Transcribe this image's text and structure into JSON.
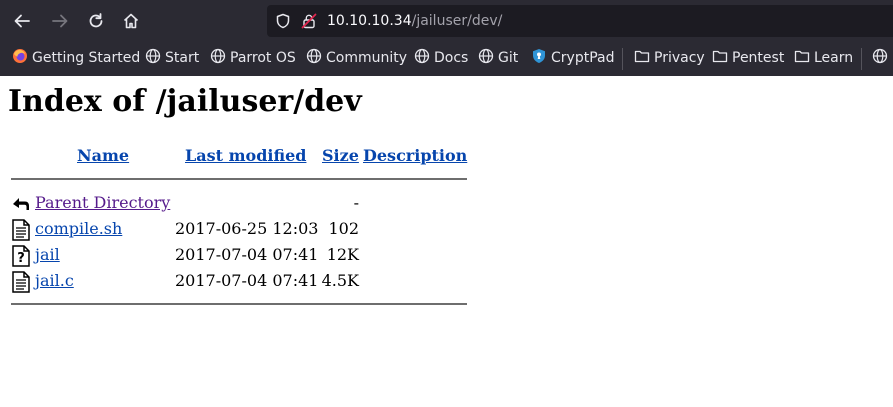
{
  "browser": {
    "url_host": "10.10.10.34",
    "url_path": "/jailuser/dev/",
    "bookmarks": [
      {
        "label": "Getting Started",
        "icon": "firefox-icon"
      },
      {
        "label": "Start",
        "icon": "globe-icon"
      },
      {
        "label": "Parrot OS",
        "icon": "globe-icon"
      },
      {
        "label": "Community",
        "icon": "globe-icon"
      },
      {
        "label": "Docs",
        "icon": "globe-icon"
      },
      {
        "label": "Git",
        "icon": "globe-icon"
      },
      {
        "label": "CryptPad",
        "icon": "cryptpad-icon"
      },
      {
        "label": "Privacy",
        "icon": "folder-icon"
      },
      {
        "label": "Pentest",
        "icon": "folder-icon"
      },
      {
        "label": "Learn",
        "icon": "folder-icon"
      }
    ]
  },
  "page": {
    "title": "Index of /jailuser/dev",
    "columns": {
      "name": "Name",
      "last_modified": "Last modified",
      "size": "Size",
      "description": "Description"
    },
    "rows": [
      {
        "name": "Parent Directory",
        "modified": "",
        "size": "-",
        "description": "",
        "icon": "back-icon",
        "visited": true
      },
      {
        "name": "compile.sh",
        "modified": "2017-06-25 12:03",
        "size": "102",
        "description": "",
        "icon": "text-file-icon",
        "visited": false
      },
      {
        "name": "jail",
        "modified": "2017-07-04 07:41",
        "size": "12K",
        "description": "",
        "icon": "unknown-file-icon",
        "visited": false
      },
      {
        "name": "jail.c",
        "modified": "2017-07-04 07:41",
        "size": "4.5K",
        "description": "",
        "icon": "text-file-icon",
        "visited": false
      }
    ]
  },
  "colors": {
    "chrome_bg": "#2b2a33",
    "urlbar_bg": "#1c1b22",
    "link": "#0645ad",
    "visited_link": "#551a8b",
    "lock_red": "#e22850"
  }
}
